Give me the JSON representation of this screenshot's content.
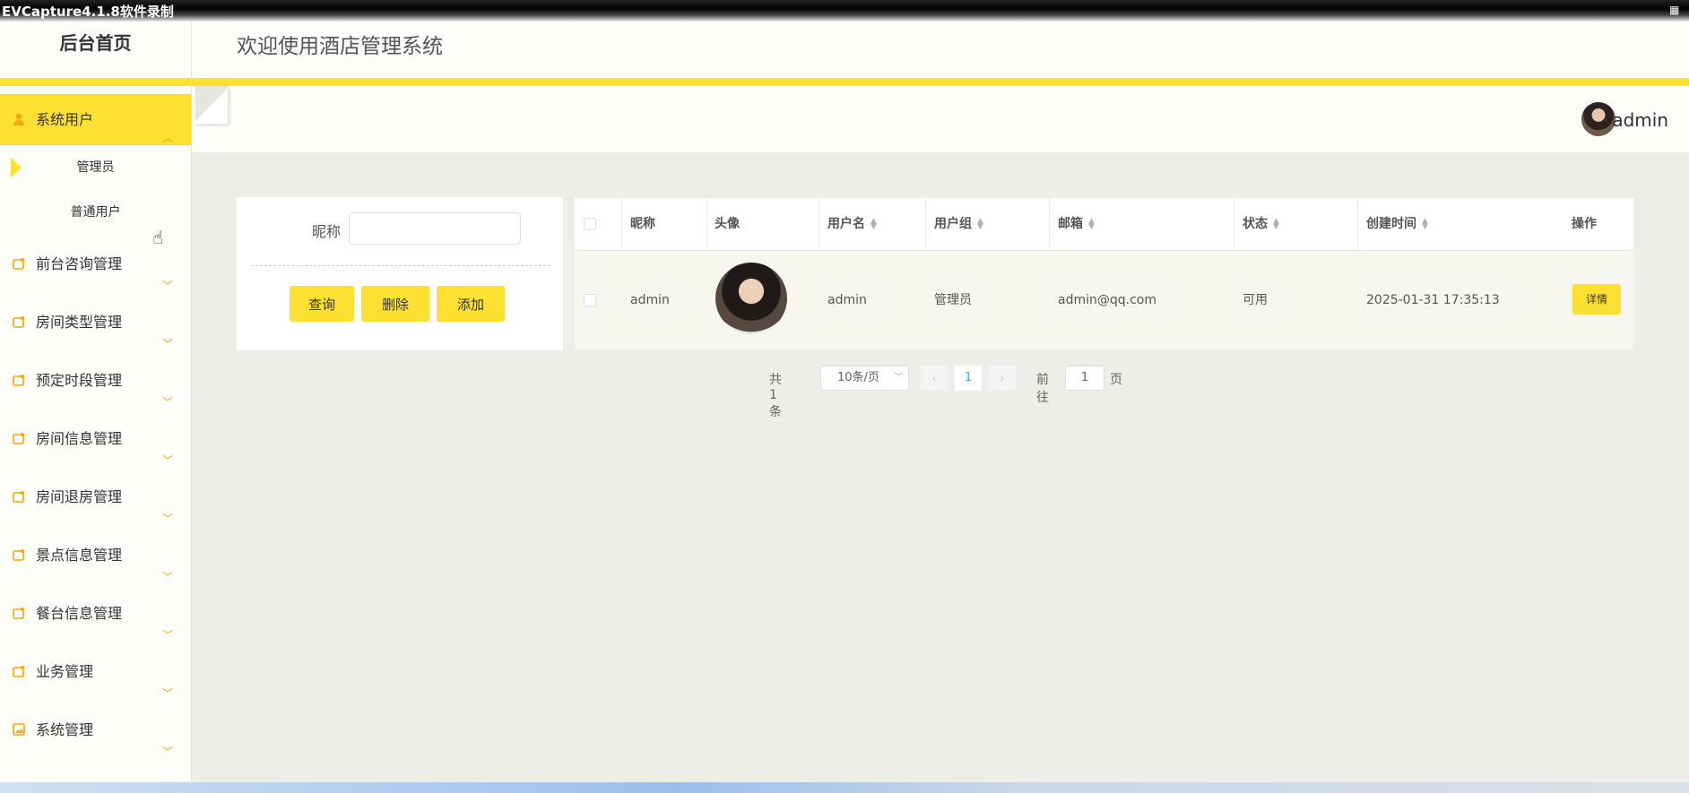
{
  "capture": {
    "title": "EVCapture4.1.8软件录制"
  },
  "sidebar": {
    "brand": "后台首页",
    "menu": [
      {
        "label": "系统用户",
        "icon": "user-icon",
        "expanded": true,
        "children": [
          "管理员",
          "普通用户"
        ]
      },
      {
        "label": "前台咨询管理",
        "icon": "folder-icon"
      },
      {
        "label": "房间类型管理",
        "icon": "folder-icon"
      },
      {
        "label": "预定时段管理",
        "icon": "folder-icon"
      },
      {
        "label": "房间信息管理",
        "icon": "folder-icon"
      },
      {
        "label": "房间退房管理",
        "icon": "folder-icon"
      },
      {
        "label": "景点信息管理",
        "icon": "folder-icon"
      },
      {
        "label": "餐台信息管理",
        "icon": "folder-icon"
      },
      {
        "label": "业务管理",
        "icon": "folder-icon"
      },
      {
        "label": "系统管理",
        "icon": "image-icon"
      }
    ]
  },
  "header": {
    "title": "欢迎使用酒店管理系统"
  },
  "user": {
    "name": "admin"
  },
  "search": {
    "nickname_label": "昵称",
    "nickname_value": "",
    "buttons": {
      "query": "查询",
      "delete": "删除",
      "add": "添加"
    }
  },
  "table": {
    "columns": [
      "昵称",
      "头像",
      "用户名",
      "用户组",
      "邮箱",
      "状态",
      "创建时间",
      "操作"
    ],
    "rows": [
      {
        "nickname": "admin",
        "username": "admin",
        "group": "管理员",
        "email": "admin@qq.com",
        "status": "可用",
        "created": "2025-01-31 17:35:13",
        "action": "详情"
      }
    ]
  },
  "pager": {
    "total": "共 1 条",
    "page_size": "10条/页",
    "current": "1",
    "goto_label": "前往",
    "goto_value": "1",
    "page_label": "页"
  },
  "colors": {
    "accent": "#fde032",
    "link": "#409eff"
  }
}
